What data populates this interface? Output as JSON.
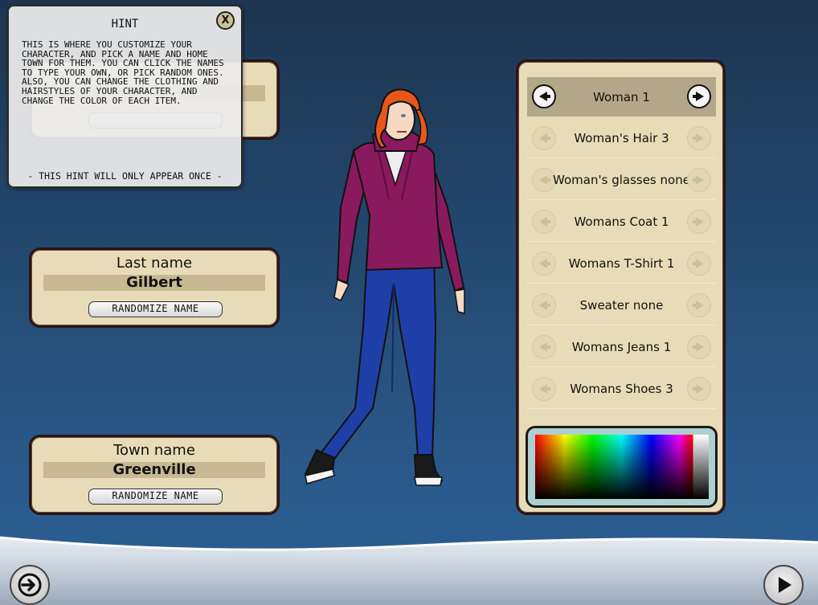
{
  "hint": {
    "title": "HINT",
    "close_label": "X",
    "text": "THIS IS WHERE YOU CUSTOMIZE YOUR CHARACTER, AND PICK A NAME AND HOME TOWN FOR THEM. YOU CAN CLICK THE NAMES TO TYPE YOUR OWN, OR PICK RANDOM ONES. ALSO, YOU CAN CHANGE THE CLOTHING AND HAIRSTYLES OF YOUR CHARACTER, AND CHANGE THE COLOR OF EACH ITEM.",
    "footer": "- THIS HINT WILL ONLY APPEAR ONCE -"
  },
  "last_name": {
    "title": "Last name",
    "value": "Gilbert",
    "randomize_label": "RANDOMIZE NAME"
  },
  "town_name": {
    "title": "Town name",
    "value": "Greenville",
    "randomize_label": "RANDOMIZE NAME"
  },
  "customize": {
    "rows": [
      {
        "label": "Woman 1",
        "active": true
      },
      {
        "label": "Woman's Hair 3",
        "active": false
      },
      {
        "label": "Woman's glasses none",
        "active": false
      },
      {
        "label": "Womans Coat 1",
        "active": false
      },
      {
        "label": "Womans T-Shirt 1",
        "active": false
      },
      {
        "label": "Sweater none",
        "active": false
      },
      {
        "label": "Womans Jeans 1",
        "active": false
      },
      {
        "label": "Womans Shoes 3",
        "active": false
      }
    ]
  },
  "colors": {
    "panel_bg": "#e8dcb8",
    "panel_border": "#2a1414",
    "hoodie": "#8a1a5e",
    "jeans": "#1f3fa8",
    "hair": "#e8571a"
  },
  "nav": {
    "back_icon": "exit-arrow-icon",
    "next_icon": "play-icon"
  }
}
